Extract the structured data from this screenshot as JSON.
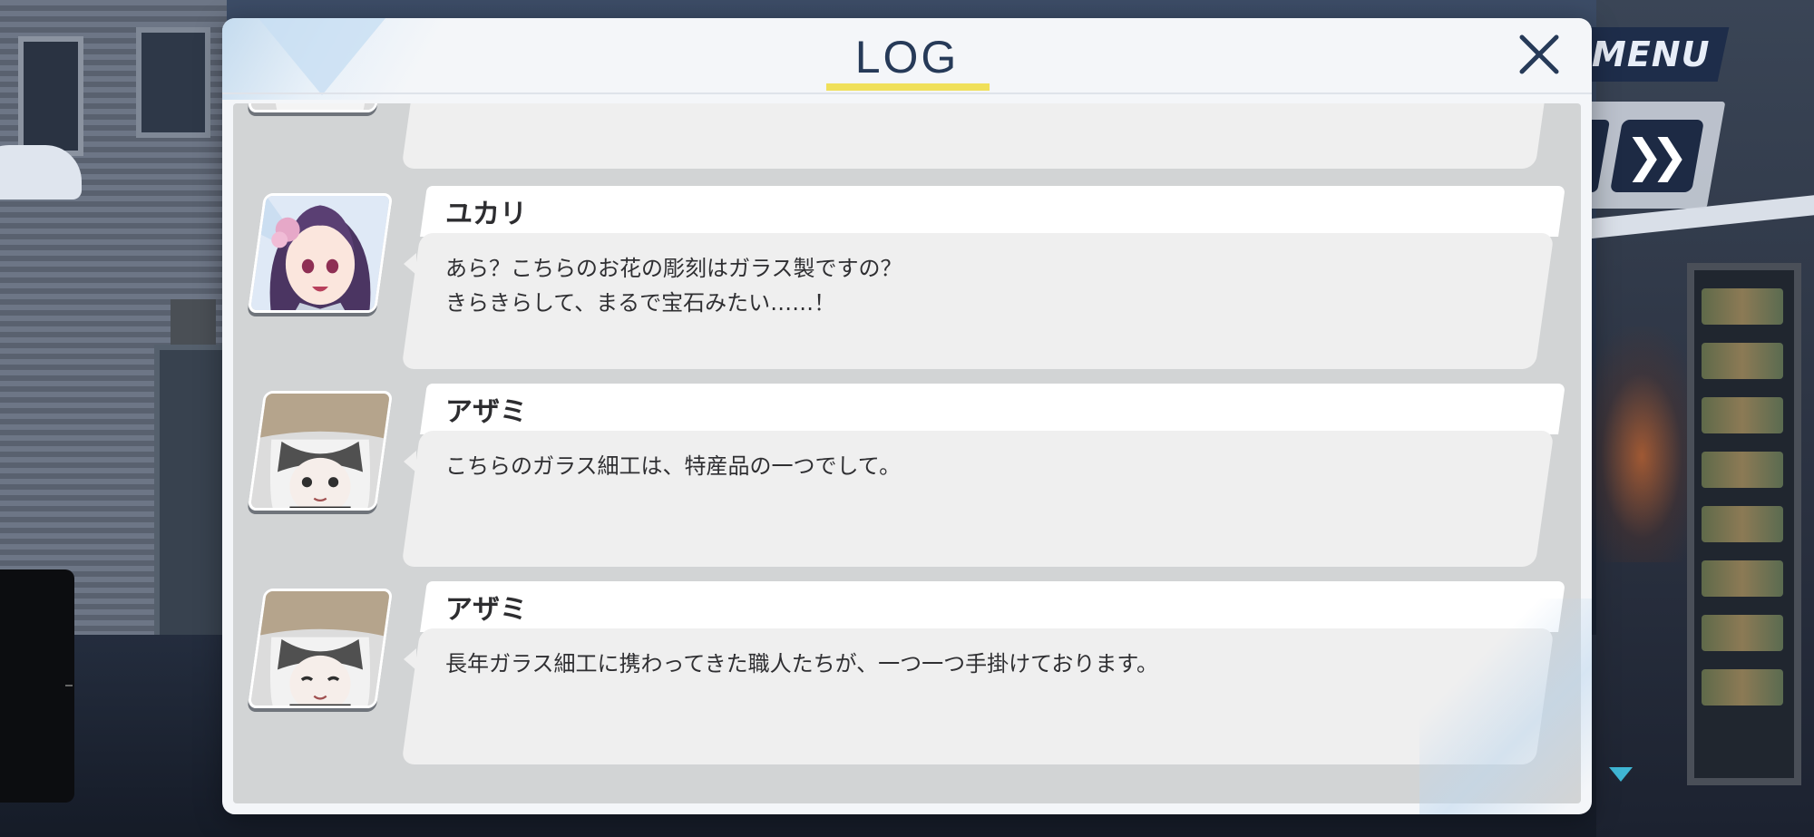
{
  "log": {
    "title": "LOG",
    "close_icon": "close-icon",
    "entries": [
      {
        "speaker": "",
        "text": "",
        "avatar": "azami-portrait",
        "partial": true
      },
      {
        "speaker": "ユカリ",
        "text": "あら？こちらのお花の彫刻はガラス製ですの？\nきらきらして、まるで宝石みたい……！",
        "avatar": "yukari-portrait"
      },
      {
        "speaker": "アザミ",
        "text": "こちらのガラス細工は、特産品の一つでして。",
        "avatar": "azami-portrait"
      },
      {
        "speaker": "アザミ",
        "text": "長年ガラス細工に携わってきた職人たちが、一つ一つ手掛けております。",
        "avatar": "azami-portrait"
      }
    ]
  },
  "game_ui": {
    "menu_label": "MENU",
    "fast_forward_icon": "fast-forward-icon",
    "scroll_down_icon": "scroll-down-icon"
  },
  "colors": {
    "title_text": "#263a58",
    "title_underline": "#f0e05a",
    "menu_bg": "#1e2d4a",
    "message_bg": "#efefef",
    "log_body_bg": "#d2d4d5"
  }
}
